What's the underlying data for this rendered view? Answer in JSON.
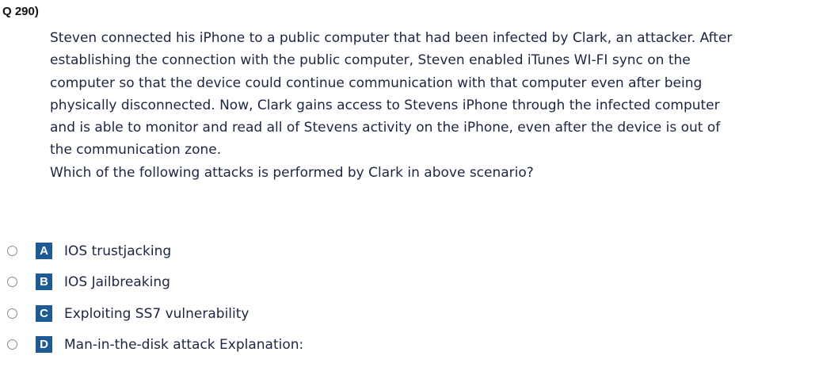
{
  "question": {
    "number": "Q 290)",
    "stem_lines": [
      "Steven connected his iPhone to a public computer that had been infected by Clark, an attacker. After",
      "establishing the connection with the public computer, Steven enabled iTunes WI-FI sync on the",
      "computer so that the device could continue communication with that computer even after being",
      "physically disconnected. Now, Clark gains access to Stevens iPhone through the infected computer",
      "and is able to monitor and read all of Stevens activity on the iPhone, even after the device is out of",
      "the communication zone.",
      "Which of the following attacks is performed by Clark in above scenario?"
    ]
  },
  "options": [
    {
      "letter": "A",
      "text": "IOS trustjacking"
    },
    {
      "letter": "B",
      "text": "IOS Jailbreaking"
    },
    {
      "letter": "C",
      "text": "Exploiting SS7 vulnerability"
    },
    {
      "letter": "D",
      "text": "Man-in-the-disk attack Explanation:"
    }
  ],
  "colors": {
    "letter_badge": "#1d5a96",
    "text": "#1c2641"
  }
}
